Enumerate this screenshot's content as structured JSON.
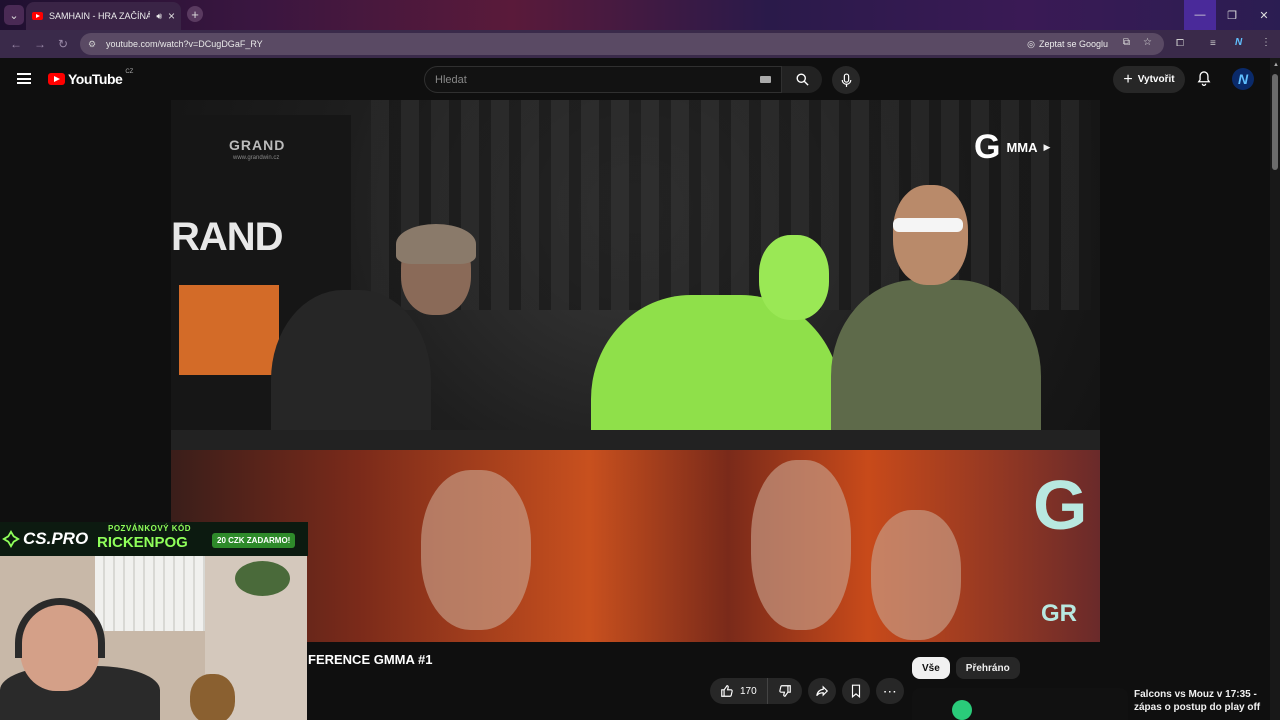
{
  "browser": {
    "tab_title": "SAMHAIN - HRA ZAČÍNÁ |",
    "url": "youtube.com/watch?v=DCugDGaF_RY",
    "ask_google": "Zeptat se Googlu"
  },
  "youtube": {
    "logo_text": "YouTube",
    "country_code": "CZ",
    "search_placeholder": "Hledat",
    "create_label": "Vytvořit",
    "avatar_letter": "N"
  },
  "video": {
    "title_visible": "FERENCE GMMA #1",
    "banner_logo": "GRAND",
    "banner_url": "www.grandwin.cz",
    "banner_big": "RAND",
    "channel_bug": "MMA"
  },
  "actions": {
    "like_count": "170"
  },
  "sidebar": {
    "chips": [
      {
        "label": "Vše",
        "active": true
      },
      {
        "label": "Přehráno",
        "active": false
      }
    ],
    "recommendation_title": "Falcons vs Mouz v 17:35 - zápas o postup do play off"
  },
  "stream_overlay": {
    "brand": "CS.PRO",
    "code_label": "POZVÁNKOVÝ KÓD",
    "code": "RICKENPOG",
    "badge": "20 CZK ZADARMO!"
  },
  "colors": {
    "yt_red": "#ff0000",
    "promo_green": "#8fff5a",
    "page_bg": "#0f0f0f"
  }
}
